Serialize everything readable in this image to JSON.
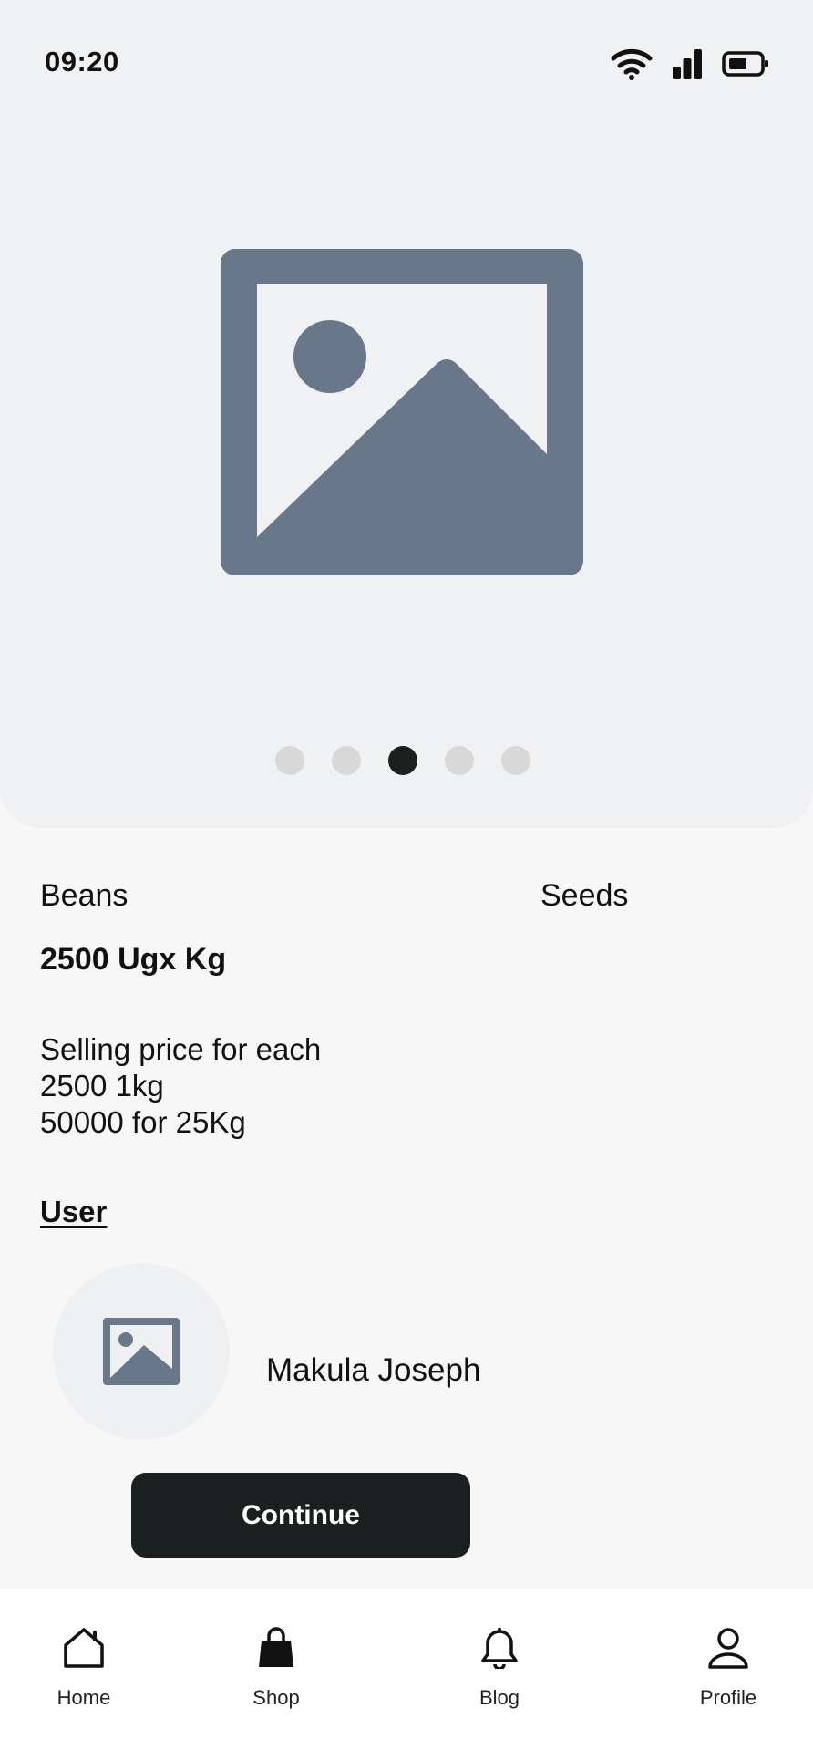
{
  "status_bar": {
    "time": "09:20",
    "icons": [
      "wifi-icon",
      "signal-icon",
      "battery-icon"
    ]
  },
  "gallery": {
    "image": "image-placeholder-icon",
    "dot_count": 5,
    "active_index": 2
  },
  "product": {
    "name": "Beans",
    "category": "Seeds",
    "price": "2500 Ugx Kg",
    "description": [
      "Selling price for each",
      "2500 1kg",
      "50000 for 25Kg"
    ]
  },
  "user": {
    "heading": "User",
    "name": "Makula Joseph",
    "avatar": "image-placeholder-icon"
  },
  "actions": {
    "continue_label": "Continue"
  },
  "nav": {
    "items": [
      {
        "label": "Home",
        "icon": "home-icon"
      },
      {
        "label": "Shop",
        "icon": "shopping-bag-icon"
      },
      {
        "label": "Blog",
        "icon": "bell-icon"
      },
      {
        "label": "Profile",
        "icon": "user-icon"
      }
    ]
  },
  "colors": {
    "hero_background": "#f0f1f3",
    "placeholder": "#687789",
    "primary_button": "#1a201f",
    "active_dot": "#1b201f",
    "inactive_dot": "#d8d8d9"
  }
}
